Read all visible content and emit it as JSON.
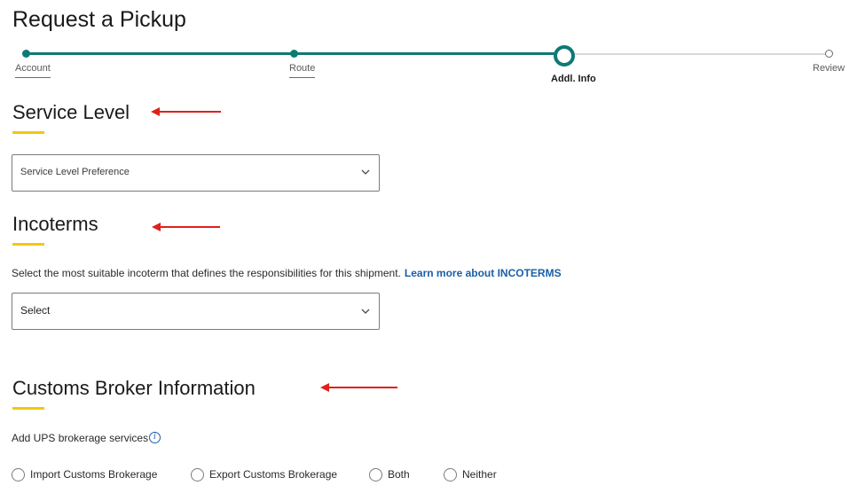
{
  "page": {
    "title": "Request a Pickup"
  },
  "stepper": {
    "steps": [
      {
        "label": "Account",
        "state": "done"
      },
      {
        "label": "Route",
        "state": "done"
      },
      {
        "label": "Addl. Info",
        "state": "current"
      },
      {
        "label": "Review",
        "state": "future"
      }
    ],
    "colors": {
      "done": "#0e7a74",
      "todo": "#d9d9d9"
    }
  },
  "service_level": {
    "title": "Service Level",
    "select_placeholder": "Service Level Preference"
  },
  "incoterms": {
    "title": "Incoterms",
    "description": "Select the most suitable incoterm that defines the responsibilities for this shipment.",
    "link": "Learn more about INCOTERMS",
    "select_value": "Select"
  },
  "customs_broker": {
    "title": "Customs Broker Information",
    "label": "Add UPS brokerage services",
    "info_icon": "i",
    "options": [
      "Import Customs Brokerage",
      "Export Customs Brokerage",
      "Both",
      "Neither"
    ]
  },
  "colors": {
    "accent_underline": "#f2c811",
    "annotation_arrow": "#e0201c",
    "link": "#1a5fa8"
  }
}
